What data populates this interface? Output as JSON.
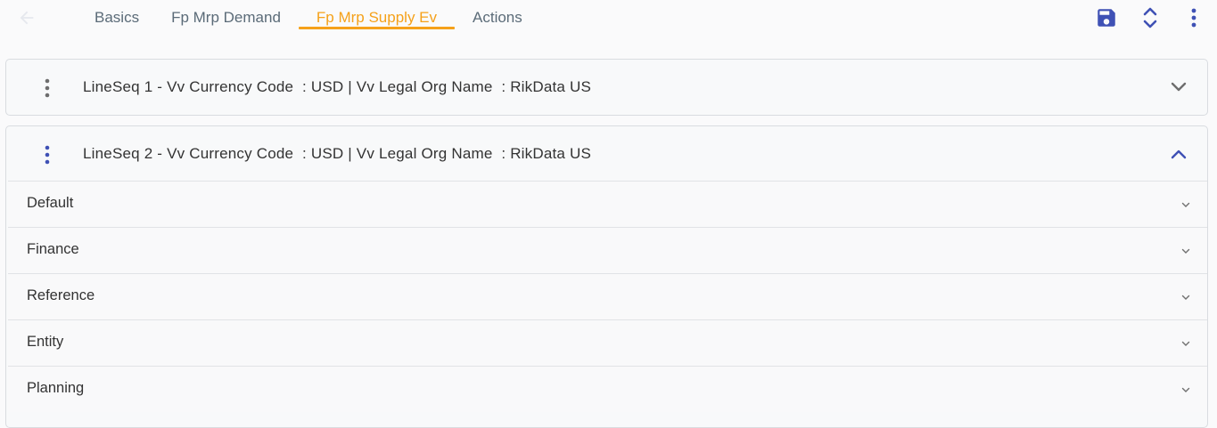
{
  "header": {
    "tabs": [
      {
        "label": "Basics",
        "active": false
      },
      {
        "label": "Fp Mrp Demand",
        "active": false
      },
      {
        "label": "Fp Mrp Supply Ev",
        "active": true
      },
      {
        "label": "Actions",
        "active": false
      }
    ],
    "icons": {
      "back": "back-arrow-icon",
      "save": "save-icon",
      "expand_collapse": "expand-collapse-icon",
      "more": "more-vertical-icon"
    }
  },
  "lines": [
    {
      "title": "LineSeq 1 - Vv Currency Code  : USD | Vv Legal Org Name  : RikData US",
      "expanded": false
    },
    {
      "title": "LineSeq 2 - Vv Currency Code  : USD | Vv Legal Org Name  : RikData US",
      "expanded": true,
      "sections": [
        "Default",
        "Finance",
        "Reference",
        "Entity",
        "Planning"
      ]
    }
  ],
  "colors": {
    "accent": "#f5a11a",
    "primary": "#3f51b5",
    "muted_icon": "#6d6d6d"
  }
}
